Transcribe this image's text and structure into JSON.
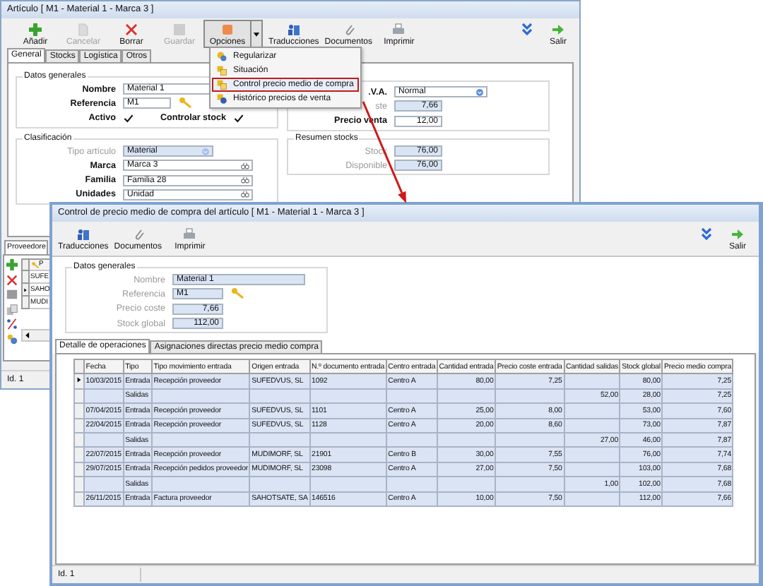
{
  "main_window": {
    "title": "Artículo  [ M1 - Material 1 -  Marca 3 ]",
    "toolbar": [
      {
        "label": "Añadir",
        "disabled": false,
        "pressed": false
      },
      {
        "label": "Cancelar",
        "disabled": true,
        "pressed": false
      },
      {
        "label": "Borrar",
        "disabled": false,
        "pressed": false
      },
      {
        "label": "Guardar",
        "disabled": true,
        "pressed": false
      },
      {
        "label": "Opciones",
        "disabled": false,
        "pressed": true
      },
      {
        "label": "Traducciones",
        "disabled": false,
        "pressed": false
      },
      {
        "label": "Documentos",
        "disabled": false,
        "pressed": false
      },
      {
        "label": "Imprimir",
        "disabled": false,
        "pressed": false
      }
    ],
    "exit": "Salir",
    "tabs": [
      {
        "label": "General",
        "selected": true
      },
      {
        "label": "Stocks",
        "selected": false
      },
      {
        "label": "Logística",
        "selected": false
      },
      {
        "label": "Otros",
        "selected": false
      }
    ],
    "datos_generales": {
      "title": "Datos generales",
      "nombre": {
        "label": "Nombre",
        "value": "Material 1"
      },
      "referencia": {
        "label": "Referencia",
        "value": "M1"
      },
      "activo": {
        "label": "Activo",
        "checked": true
      },
      "controlar_stock": {
        "label": "Controlar stock",
        "checked": true
      }
    },
    "precios": [
      {
        "label": ".V.A.",
        "value": "Normal",
        "kind": "combo",
        "disabled": false
      },
      {
        "label": "ste",
        "value": "7,66",
        "kind": "number",
        "disabled": true
      },
      {
        "label": "Precio venta",
        "value": "12,00",
        "kind": "input",
        "disabled": false
      }
    ],
    "clasificacion": {
      "title": "Clasificación",
      "fields": [
        {
          "label": "Tipo artículo",
          "value": "Material",
          "kind": "combo",
          "disabled": true
        },
        {
          "label": "Marca",
          "value": "Marca 3",
          "kind": "lookup",
          "disabled": false
        },
        {
          "label": "Familia",
          "value": "Familia 28",
          "kind": "lookup",
          "disabled": false
        },
        {
          "label": "Unidades",
          "value": "Unidad",
          "kind": "lookup",
          "disabled": false
        }
      ]
    },
    "resumen_stocks": {
      "title": "Resumen stocks",
      "fields": [
        {
          "label": "Stock",
          "value": "76,00"
        },
        {
          "label": "Disponible",
          "value": "76,00"
        }
      ]
    },
    "proveedores": {
      "tab": "Proveedore",
      "header": "P",
      "rows": [
        {
          "text": "SUFE",
          "current": false
        },
        {
          "text": "SAHO",
          "current": true
        },
        {
          "text": "MUDI",
          "current": false
        }
      ]
    },
    "status": "Id. 1"
  },
  "options_menu": {
    "items": [
      {
        "label": "Regularizar",
        "highlighted": false
      },
      {
        "label": "Situación",
        "highlighted": false
      },
      {
        "label": "Control precio medio de compra",
        "highlighted": true
      },
      {
        "label": "Histórico precios de venta",
        "highlighted": false
      }
    ]
  },
  "cost_window": {
    "title": "Control de precio medio de compra del artículo  [ M1 - Material 1  -  Marca 3 ]",
    "toolbar": [
      "Traducciones",
      "Documentos",
      "Imprimir"
    ],
    "exit": "Salir",
    "datos_generales": {
      "title": "Datos generales",
      "fields": [
        {
          "label": "Nombre",
          "value": "Material 1",
          "kind": "wide"
        },
        {
          "label": "Referencia",
          "value": "M1",
          "kind": "reference"
        },
        {
          "label": "Precio coste",
          "value": "7,66",
          "kind": "number"
        },
        {
          "label": "Stock global",
          "value": "112,00",
          "kind": "number"
        }
      ]
    },
    "tabs": [
      {
        "label": "Detalle de operaciones",
        "selected": true
      },
      {
        "label": "Asignaciones directas precio medio compra",
        "selected": false
      }
    ],
    "table": {
      "columns": [
        "Fecha",
        "Tipo",
        "Tipo movimiento entrada",
        "Origen entrada",
        "N.º documento entrada",
        "Centro entrada",
        "Cantidad entrada",
        "Precio coste entrada",
        "Cantidad salidas",
        "Stock global",
        "Precio medio compra"
      ],
      "rows": [
        {
          "current": true,
          "cells": [
            "10/03/2015",
            "Entrada",
            "Recepción proveedor",
            "SUFEDVUS, SL",
            "1092",
            "Centro A",
            "80,00",
            "7,25",
            "",
            "80,00",
            "7,25"
          ]
        },
        {
          "current": false,
          "cells": [
            "",
            "Salidas",
            "",
            "",
            "",
            "",
            "",
            "",
            "52,00",
            "28,00",
            "7,25"
          ]
        },
        {
          "current": false,
          "cells": [
            "07/04/2015",
            "Entrada",
            "Recepción proveedor",
            "SUFEDVUS, SL",
            "1101",
            "Centro A",
            "25,00",
            "8,00",
            "",
            "53,00",
            "7,60"
          ]
        },
        {
          "current": false,
          "cells": [
            "22/04/2015",
            "Entrada",
            "Recepción proveedor",
            "SUFEDVUS, SL",
            "1128",
            "Centro A",
            "20,00",
            "8,60",
            "",
            "73,00",
            "7,87"
          ]
        },
        {
          "current": false,
          "cells": [
            "",
            "Salidas",
            "",
            "",
            "",
            "",
            "",
            "",
            "27,00",
            "46,00",
            "7,87"
          ]
        },
        {
          "current": false,
          "cells": [
            "22/07/2015",
            "Entrada",
            "Recepción proveedor",
            "MUDIMORF, SL",
            "21901",
            "Centro B",
            "30,00",
            "7,55",
            "",
            "76,00",
            "7,74"
          ]
        },
        {
          "current": false,
          "cells": [
            "29/07/2015",
            "Entrada",
            "Recepción pedidos proveedor",
            "MUDIMORF, SL",
            "23098",
            "Centro A",
            "27,00",
            "7,50",
            "",
            "103,00",
            "7,68"
          ]
        },
        {
          "current": false,
          "cells": [
            "",
            "Salidas",
            "",
            "",
            "",
            "",
            "",
            "",
            "1,00",
            "102,00",
            "7,68"
          ]
        },
        {
          "current": false,
          "cells": [
            "26/11/2015",
            "Entrada",
            "Factura proveedor",
            "SAHOTSATE, SA",
            "146516",
            "Centro A",
            "10,00",
            "7,50",
            "",
            "112,00",
            "7,66"
          ]
        }
      ]
    },
    "status": "Id. 1"
  }
}
